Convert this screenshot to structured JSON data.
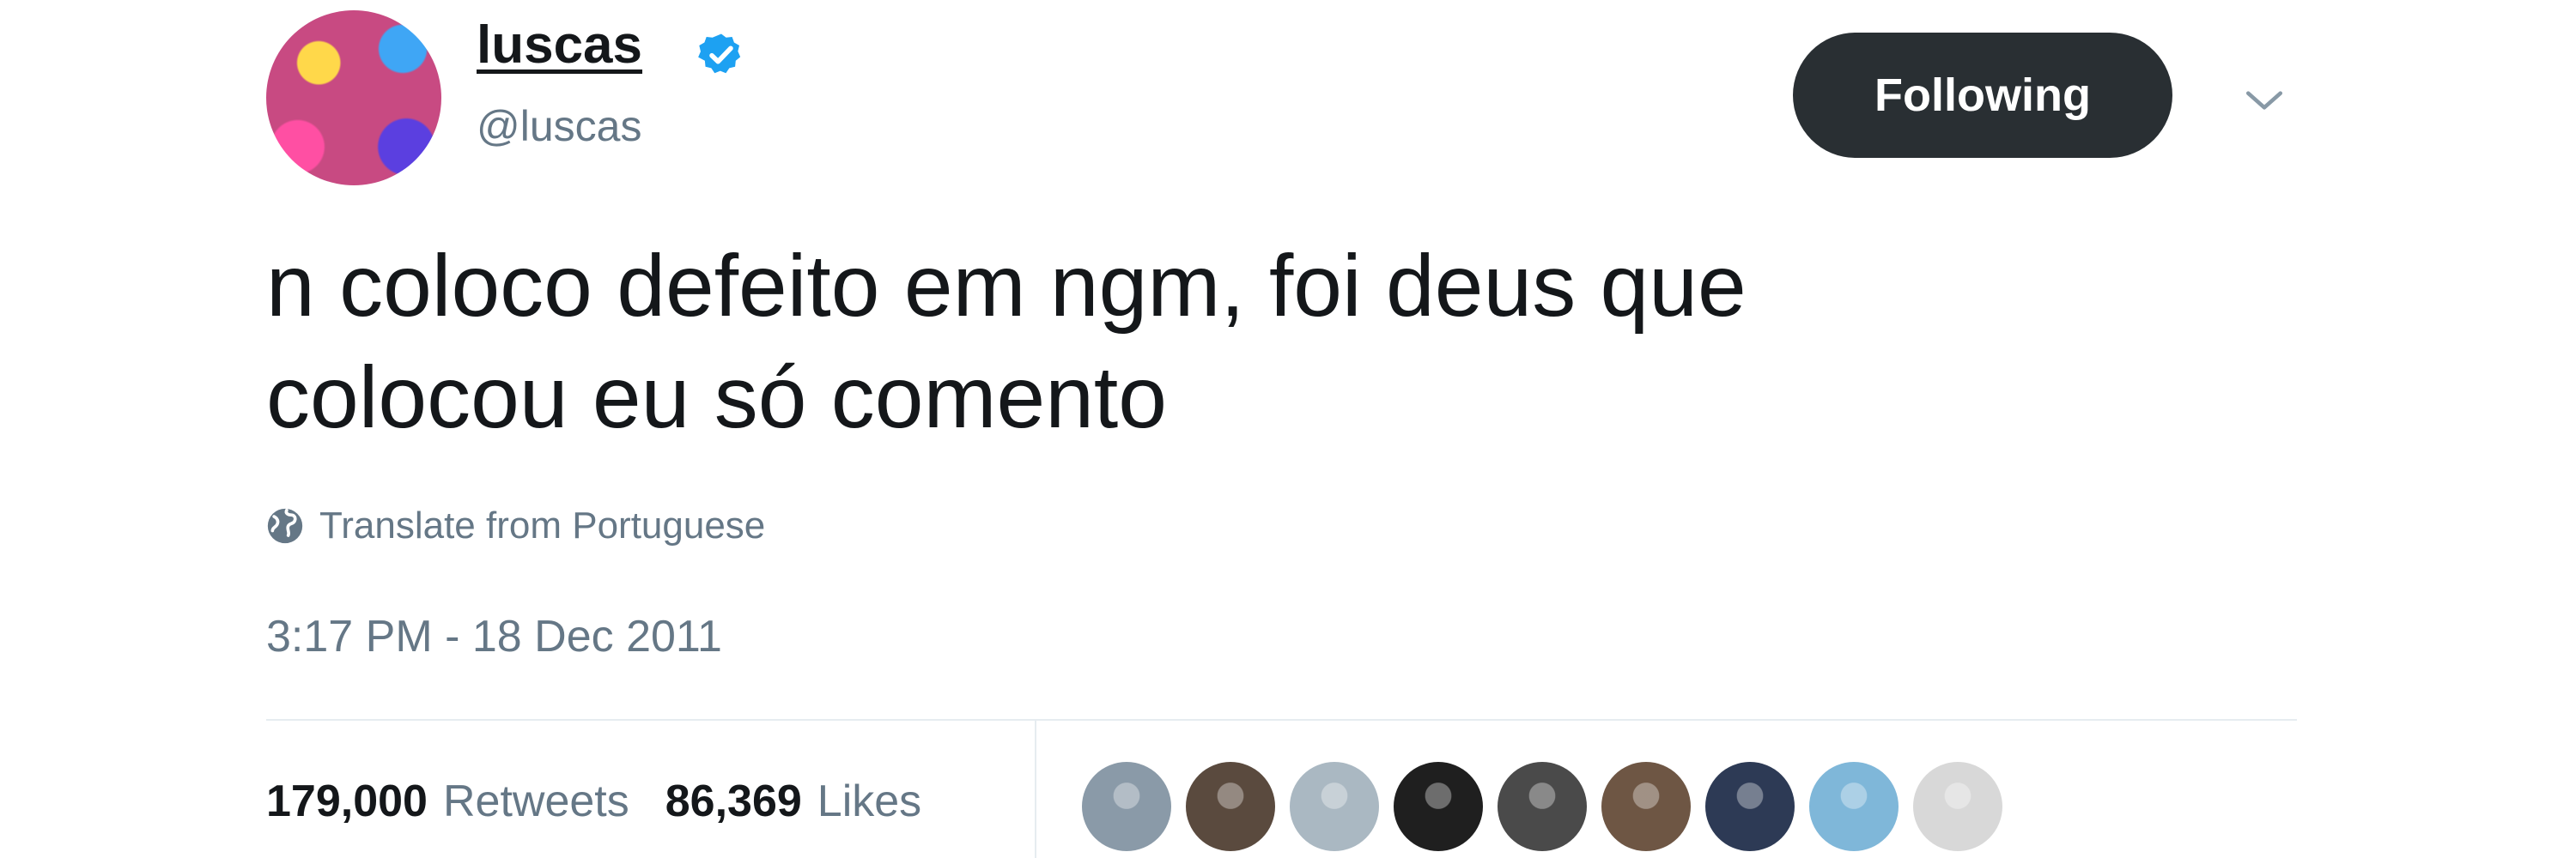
{
  "user": {
    "display_name": "luscas",
    "handle": "@luscas",
    "verified": true,
    "avatar_icon": "avatar-photo"
  },
  "actions": {
    "follow_label": "Following",
    "menu_icon": "chevron-down-icon"
  },
  "tweet": {
    "text": "n coloco defeito em ngm, foi deus que\ncolocou eu só comento",
    "translate_label": "Translate from Portuguese",
    "timestamp": "3:17 PM - 18 Dec 2011"
  },
  "stats": {
    "retweets_count": "179,000",
    "retweets_label": "Retweets",
    "likes_count": "86,369",
    "likes_label": "Likes"
  },
  "likers": [
    {
      "name": "liker-avatar-1",
      "color": "#8a9aa8"
    },
    {
      "name": "liker-avatar-2",
      "color": "#5a4a3e"
    },
    {
      "name": "liker-avatar-3",
      "color": "#aab8c2"
    },
    {
      "name": "liker-avatar-4",
      "color": "#1f1f1f"
    },
    {
      "name": "liker-avatar-5",
      "color": "#4a4a4a"
    },
    {
      "name": "liker-avatar-6",
      "color": "#6e5644"
    },
    {
      "name": "liker-avatar-7",
      "color": "#2d3a55"
    },
    {
      "name": "liker-avatar-8",
      "color": "#7fb7d9"
    },
    {
      "name": "liker-avatar-9",
      "color": "#d8d8d8"
    }
  ],
  "colors": {
    "accent": "#1da1f2",
    "text_primary": "#14171a",
    "text_secondary": "#657786",
    "button_bg": "#292f33",
    "divider": "#e6ecf0"
  }
}
